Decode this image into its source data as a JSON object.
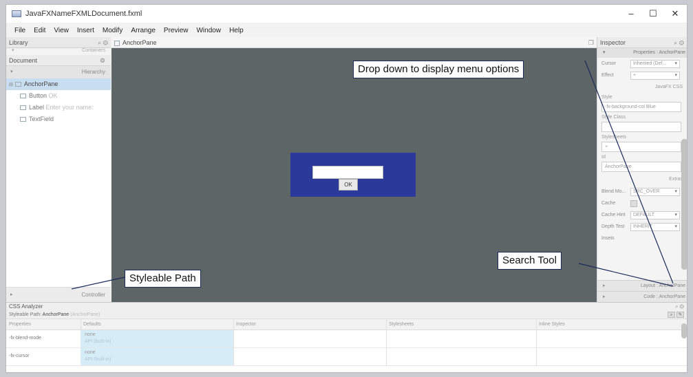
{
  "window": {
    "title": "JavaFXNameFXMLDocument.fxml",
    "minimize": "–",
    "maximize": "☐",
    "close": "✕"
  },
  "menubar": [
    "File",
    "Edit",
    "View",
    "Insert",
    "Modify",
    "Arrange",
    "Preview",
    "Window",
    "Help"
  ],
  "library": {
    "title": "Library",
    "controls": "⌕  ⚙",
    "subheader": "Containers",
    "arrow": "▾"
  },
  "document": {
    "title": "Document",
    "controls": "⚙",
    "hierarchy_label": "Hierarchy",
    "arrow": "▾",
    "tree": [
      {
        "name": "AnchorPane",
        "detail": "",
        "selected": true,
        "icon": "anchorpane-icon"
      },
      {
        "name": "Button",
        "detail": "OK",
        "selected": false,
        "icon": "button-icon"
      },
      {
        "name": "Label",
        "detail": "Enter your name:",
        "selected": false,
        "icon": "label-icon"
      },
      {
        "name": "TextField",
        "detail": "",
        "selected": false,
        "icon": "textfield-icon"
      }
    ],
    "controller_label": "Controller",
    "controller_arrow": "▸"
  },
  "canvas": {
    "tab": "AnchorPane",
    "expand_icon": "❐",
    "button_text": "OK",
    "background": "#5e6567",
    "anchor_color": "#2b3a9a"
  },
  "inspector": {
    "title": "Inspector",
    "controls": "⌕  ⚙",
    "properties_header": "Properties : AnchorPane",
    "arrow": "▾",
    "cursor_label": "Cursor",
    "cursor_value": "Inherited (Def...",
    "effect_label": "Effect",
    "effect_value": "+",
    "css_section": "JavaFX CSS",
    "style_label": "Style",
    "style_value": "-fx-background-col  Blue",
    "styleclass_label": "Style Class",
    "stylesheets_label": "Stylesheets",
    "stylesheets_value": "+",
    "id_label": "Id",
    "id_value": "AnchorPane",
    "extras_section": "Extras",
    "blend_label": "Blend Mo...",
    "blend_value": "SRC_OVER",
    "cache_label": "Cache",
    "cachehint_label": "Cache Hint",
    "cachehint_value": "DEFAULT",
    "depth_label": "Depth Test",
    "depth_value": "INHERIT",
    "insets_label": "Insets",
    "layout_bar": "Layout : AnchorPane",
    "code_bar": "Code : AnchorPane",
    "bar_arrow": "▸"
  },
  "css_analyzer": {
    "title": "CSS Analyzer",
    "controls": "⌕  ⚙",
    "path_label": "Styleable Path:",
    "path_value": "AnchorPane",
    "path_detail": "(AnchorPane)",
    "columns": [
      "Properties",
      "Defaults",
      "Inspector",
      "Stylesheets",
      "Inline Styles"
    ],
    "rows": [
      {
        "property": "-fx-blend-mode",
        "default": "none",
        "source": "API (built-in)"
      },
      {
        "property": "-fx-cursor",
        "default": "none",
        "source": "API (built-in)"
      }
    ],
    "tool_icons": [
      "⌕",
      "✎"
    ]
  },
  "annotations": {
    "dropdown": "Drop down to display menu options",
    "search": "Search Tool",
    "styleable": "Styleable Path"
  }
}
